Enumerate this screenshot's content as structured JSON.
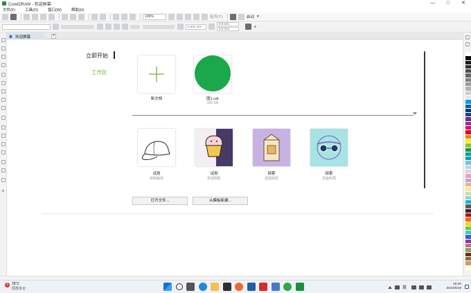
{
  "window": {
    "title": "CorelDRAW - 欢迎屏幕",
    "controls": [
      "—",
      "□",
      "✕"
    ]
  },
  "menu": [
    "文件(F)",
    "工具(O)",
    "窗口(W)",
    "帮助(H)"
  ],
  "toolbar": {
    "zoom": "100%",
    "snap_label": "贴齐(T)",
    "launch_label": "启动"
  },
  "propertybar": {
    "nudge": "0.201 mm",
    "dup_x": "5.0 mm",
    "dup_y": "5.0 mm"
  },
  "tabs": [
    {
      "label": "欢迎屏幕"
    }
  ],
  "welcome": {
    "nav_title": "立即开始",
    "nav_workspace": "工作区",
    "new_doc_label": "新文档",
    "recent_file": {
      "name": "图1.cdr",
      "size": "305 KB"
    },
    "learn": [
      {
        "title": "试用",
        "subtitle": "绘制曲线"
      },
      {
        "title": "试用",
        "subtitle": "添加阴影"
      },
      {
        "title": "探索",
        "subtitle": "透视投影"
      },
      {
        "title": "探索",
        "subtitle": "页面布局"
      }
    ],
    "open_file_button": "打开文件...",
    "from_template_button": "从模板新建..."
  },
  "palette_colors": [
    "#ffffff",
    "#000000",
    "#1a1a1a",
    "#333333",
    "#4d4d4d",
    "#666666",
    "#808080",
    "#999999",
    "#b3b3b3",
    "#cccccc",
    "#e6e6e6",
    "#00a0e9",
    "#0060a8",
    "#003f7f",
    "#1e3f8c",
    "#6a2f8e",
    "#9b2c8c",
    "#e4007f",
    "#e60012",
    "#f08300",
    "#fff100",
    "#8fc31f",
    "#009944",
    "#009e96",
    "#00a0c1",
    "#7fbfe0",
    "#b5d9ef",
    "#f7c7d8",
    "#e5a3c4",
    "#c9a0d6",
    "#f4b183",
    "#ffe699",
    "#c6e0b4",
    "#9bd4c6",
    "#00b7ee",
    "#5b5b5b",
    "#2b2b2b",
    "#c00000",
    "#ff6600",
    "#ffcc00",
    "#66cc33",
    "#33cccc",
    "#3366cc",
    "#993399",
    "#cc6699",
    "#999966",
    "#663300",
    "#996633",
    "#cc9966",
    "#ffffcc"
  ],
  "taskbar": {
    "weather_badge": "1",
    "temperature": "28°C",
    "condition": "局部多云",
    "language": "英",
    "time": "19:40",
    "date": "2024/6/19"
  }
}
